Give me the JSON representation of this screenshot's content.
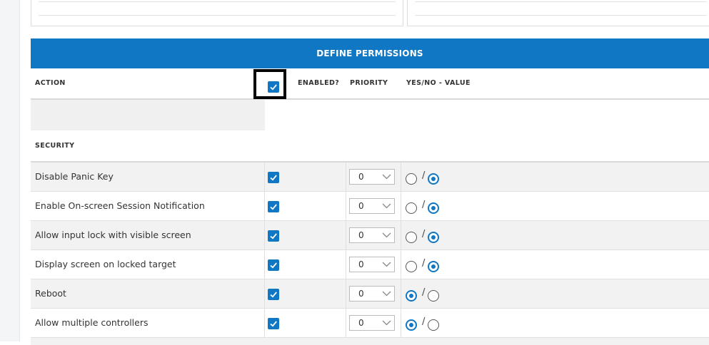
{
  "header": {
    "title": "DEFINE PERMISSIONS"
  },
  "columns": {
    "action": "ACTION",
    "enabled": "ENABLED?",
    "priority": "PRIORITY",
    "value": "YES/NO - VALUE"
  },
  "select_all_checked": true,
  "section": {
    "title": "SECURITY"
  },
  "rows": [
    {
      "label": "Disable Panic Key",
      "enabled": true,
      "priority": "0",
      "value": "no"
    },
    {
      "label": "Enable On-screen Session Notification",
      "enabled": true,
      "priority": "0",
      "value": "no"
    },
    {
      "label": "Allow input lock with visible screen",
      "enabled": true,
      "priority": "0",
      "value": "no"
    },
    {
      "label": "Display screen on locked target",
      "enabled": true,
      "priority": "0",
      "value": "no"
    },
    {
      "label": "Reboot",
      "enabled": true,
      "priority": "0",
      "value": "yes"
    },
    {
      "label": "Allow multiple controllers",
      "enabled": true,
      "priority": "0",
      "value": "yes"
    }
  ],
  "separator": "/",
  "colors": {
    "accent": "#0f77c4",
    "row_alt": "#f2f2f2"
  },
  "icons": {
    "checkbox": "checkmark-icon",
    "dropdown": "chevron-down-icon"
  }
}
